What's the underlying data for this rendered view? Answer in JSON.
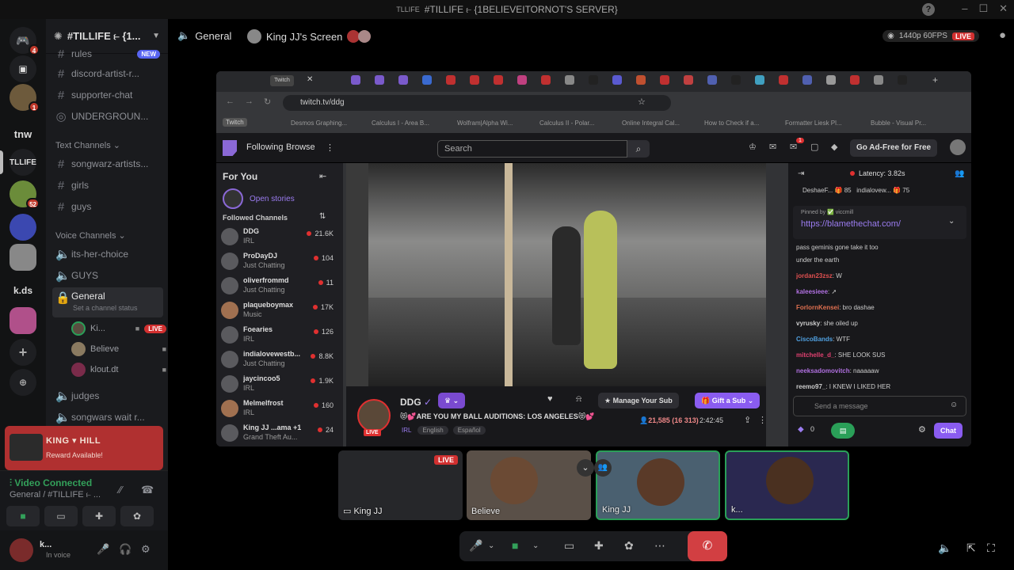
{
  "window": {
    "title": "#TILLIFE ⥼ {1BELIEVEITORNOT'S SERVER}",
    "title_prefix": "TLLIFE",
    "controls": [
      "–",
      "☐",
      "✕"
    ]
  },
  "rail": {
    "items": [
      {
        "label": "",
        "badge": "4",
        "icon": "discord-icon"
      },
      {
        "label": "",
        "badge": "",
        "icon": "inbox-icon"
      },
      {
        "label": "",
        "badge": "1",
        "icon": "avatar"
      },
      {
        "label": "tnw",
        "badge": ""
      },
      {
        "label": "TLLIFE",
        "badge": ""
      },
      {
        "label": "",
        "badge": "52"
      },
      {
        "label": "",
        "badge": ""
      },
      {
        "label": "",
        "badge": ""
      },
      {
        "label": "k.ds",
        "badge": ""
      },
      {
        "label": "",
        "badge": ""
      }
    ],
    "add_server": "+",
    "explore": "⊕"
  },
  "sidebar": {
    "server_name": "#TILLIFE ⥼ {1...",
    "channels_top": [
      {
        "name": "rules",
        "badge": "NEW"
      },
      {
        "name": "discord-artist-r...",
        "badge": ""
      },
      {
        "name": "supporter-chat",
        "badge": ""
      },
      {
        "name": "UNDERGROUN...",
        "badge": ""
      }
    ],
    "text_category": "Text Channels",
    "text_channels": [
      "songwarz-artists...",
      "girls",
      "guys"
    ],
    "voice_category": "Voice Channels",
    "voice_channels_top": [
      "its-her-choice",
      "GUYS"
    ],
    "active_channel": {
      "name": "General",
      "status": "Set a channel status"
    },
    "voice_users": [
      {
        "name": "Ki...",
        "live": "LIVE"
      },
      {
        "name": "Believe",
        "live": ""
      },
      {
        "name": "klout.dt",
        "live": ""
      }
    ],
    "voice_channels_bottom": [
      "judges",
      "songwars wait r..."
    ]
  },
  "promo": {
    "title": "KING ▾ HILL",
    "subtitle": "Reward Available!"
  },
  "voice_panel": {
    "status": "Video Connected",
    "detail": "General / #TILLIFE ⥼ ..."
  },
  "user_panel": {
    "name": "k...",
    "status": "In voice"
  },
  "stage": {
    "channel": "General",
    "screen_label": "King JJ's Screen",
    "quality": "1440p 60FPS",
    "live": "LIVE"
  },
  "browser": {
    "active_tab": "Twitch",
    "url": "twitch.tv/ddg",
    "bookmarks": [
      "Twitch",
      "Desmos Graphing...",
      "Calculus I - Area B...",
      "Wolfram|Alpha Wi...",
      "Calculus II - Polar...",
      "Online Integral Cal...",
      "How to Check if a...",
      "Formatter Liesk Pl...",
      "Bubble - Visual Pr..."
    ]
  },
  "twitch": {
    "nav": {
      "following": "Following",
      "browse": "Browse",
      "search_placeholder": "Search",
      "adfree": "Go Ad-Free for Free",
      "notif_badge": "1"
    },
    "sidebar": {
      "for_you": "For You",
      "open_stories": "Open stories",
      "followed": "Followed Channels",
      "channels": [
        {
          "name": "DDG",
          "game": "IRL",
          "viewers": "21.6K"
        },
        {
          "name": "ProDayDJ",
          "game": "Just Chatting",
          "viewers": "104"
        },
        {
          "name": "oliverfrommd",
          "game": "Just Chatting",
          "viewers": "11"
        },
        {
          "name": "plaqueboymax",
          "game": "Music",
          "viewers": "17K"
        },
        {
          "name": "Foearies",
          "game": "IRL",
          "viewers": "126"
        },
        {
          "name": "indialovewestb...",
          "game": "Just Chatting",
          "viewers": "8.8K"
        },
        {
          "name": "jaycincoo5",
          "game": "IRL",
          "viewers": "1.9K"
        },
        {
          "name": "Melmelfrost",
          "game": "IRL",
          "viewers": "160"
        },
        {
          "name": "King JJ ...ama +1",
          "game": "Grand Theft Au...",
          "viewers": "24"
        }
      ]
    },
    "stream": {
      "channel": "DDG",
      "live": "LIVE",
      "title": "😻💕ARE YOU MY BALL AUDITIONS: LOS ANGELES😻💕",
      "category": "IRL",
      "tags": [
        "English",
        "Español"
      ],
      "manage_sub": "Manage Your Sub",
      "gift_sub": "Gift a Sub",
      "viewers": "21,585 (16 313)",
      "uptime": "2:42:45"
    },
    "chat": {
      "latency": "Latency: 3.82s",
      "gifters": [
        {
          "name": "DeshaeF...",
          "count": "85"
        },
        {
          "name": "indialovew...",
          "count": "75"
        }
      ],
      "pinned_by": "Pinned by ✅ viccmill",
      "pinned_link": "https://blamethechat.com/",
      "messages": [
        {
          "user": "",
          "text": "pass geminis gone take it too",
          "color": "#e05050"
        },
        {
          "user": "",
          "text": "under the earth",
          "color": "#ccc"
        },
        {
          "user": "jordan23zsz",
          "text": ": W",
          "color": "#e05050"
        },
        {
          "user": "kaleesieee",
          "text": ": ➚",
          "color": "#b070e0"
        },
        {
          "user": "ForlornKensei",
          "text": ": bro dashae",
          "color": "#e07050"
        },
        {
          "user": "vyrusky",
          "text": ": she oiled up",
          "color": "#ccc"
        },
        {
          "user": "CiscoBands",
          "text": ": WTF",
          "color": "#50a0e0"
        },
        {
          "user": "mitchelle_d_",
          "text": ": SHE LOOK SUS",
          "color": "#e04070"
        },
        {
          "user": "neeksadomovitch",
          "text": ": naaaaaw",
          "color": "#b070e0"
        },
        {
          "user": "reemo97_",
          "text": ": I KNEW I LIKED HER",
          "color": "#ccc"
        }
      ],
      "send_placeholder": "Send a message",
      "points": "0",
      "chat_button": "Chat"
    }
  },
  "tiles": [
    {
      "name": "King JJ",
      "live": "LIVE"
    },
    {
      "name": "Believe",
      "live": ""
    },
    {
      "name": "King JJ",
      "live": ""
    },
    {
      "name": "k...",
      "live": ""
    }
  ]
}
